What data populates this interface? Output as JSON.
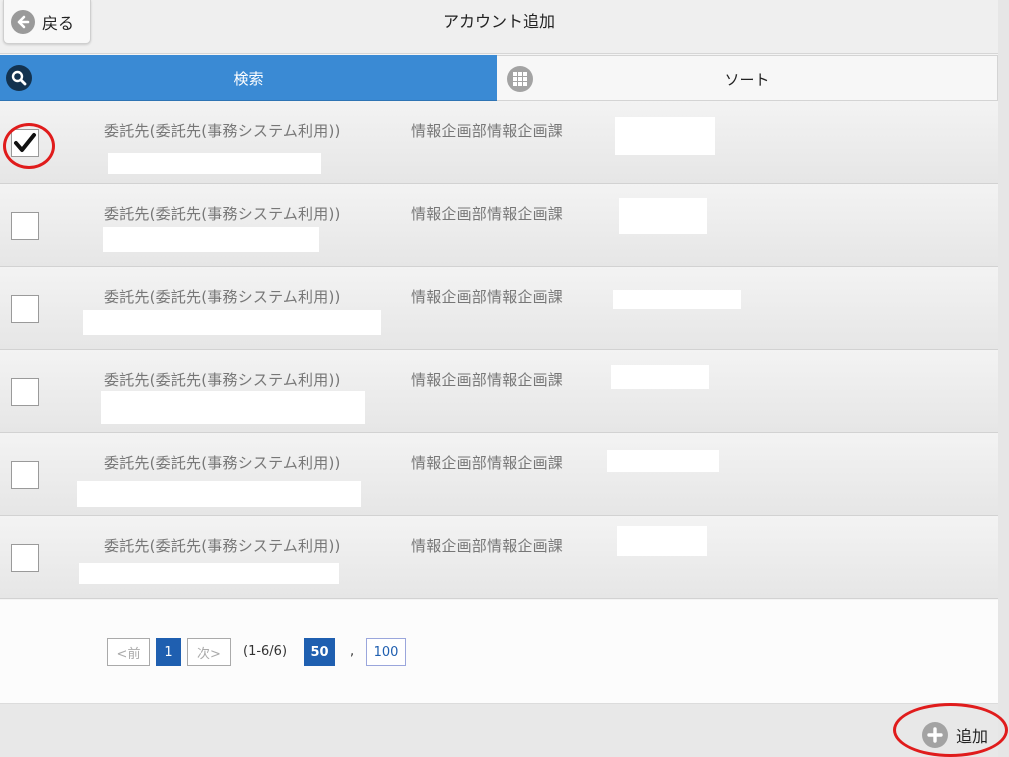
{
  "header": {
    "back_label": "戻る",
    "title": "アカウント追加"
  },
  "tabs": {
    "search_label": "検索",
    "sort_label": "ソート"
  },
  "rows": [
    {
      "col1": "委託先(委託先(事務システム利用))",
      "col2": "情報企画部情報企画課",
      "checked": true
    },
    {
      "col1": "委託先(委託先(事務システム利用))",
      "col2": "情報企画部情報企画課",
      "checked": false
    },
    {
      "col1": "委託先(委託先(事務システム利用))",
      "col2": "情報企画部情報企画課",
      "checked": false
    },
    {
      "col1": "委託先(委託先(事務システム利用))",
      "col2": "情報企画部情報企画課",
      "checked": false
    },
    {
      "col1": "委託先(委託先(事務システム利用))",
      "col2": "情報企画部情報企画課",
      "checked": false
    },
    {
      "col1": "委託先(委託先(事務システム利用))",
      "col2": "情報企画部情報企画課",
      "checked": false
    }
  ],
  "pager": {
    "prev_label": "<前",
    "current_page": "1",
    "next_label": "次>",
    "range": "(1-6/6)",
    "per_page_50": "50",
    "separator": ",",
    "per_page_100": "100"
  },
  "footer": {
    "add_label": "追加"
  },
  "colors": {
    "tab_active": "#3a8ad4",
    "pager_active": "#1f5fb0",
    "annotation": "#e01c1c"
  }
}
